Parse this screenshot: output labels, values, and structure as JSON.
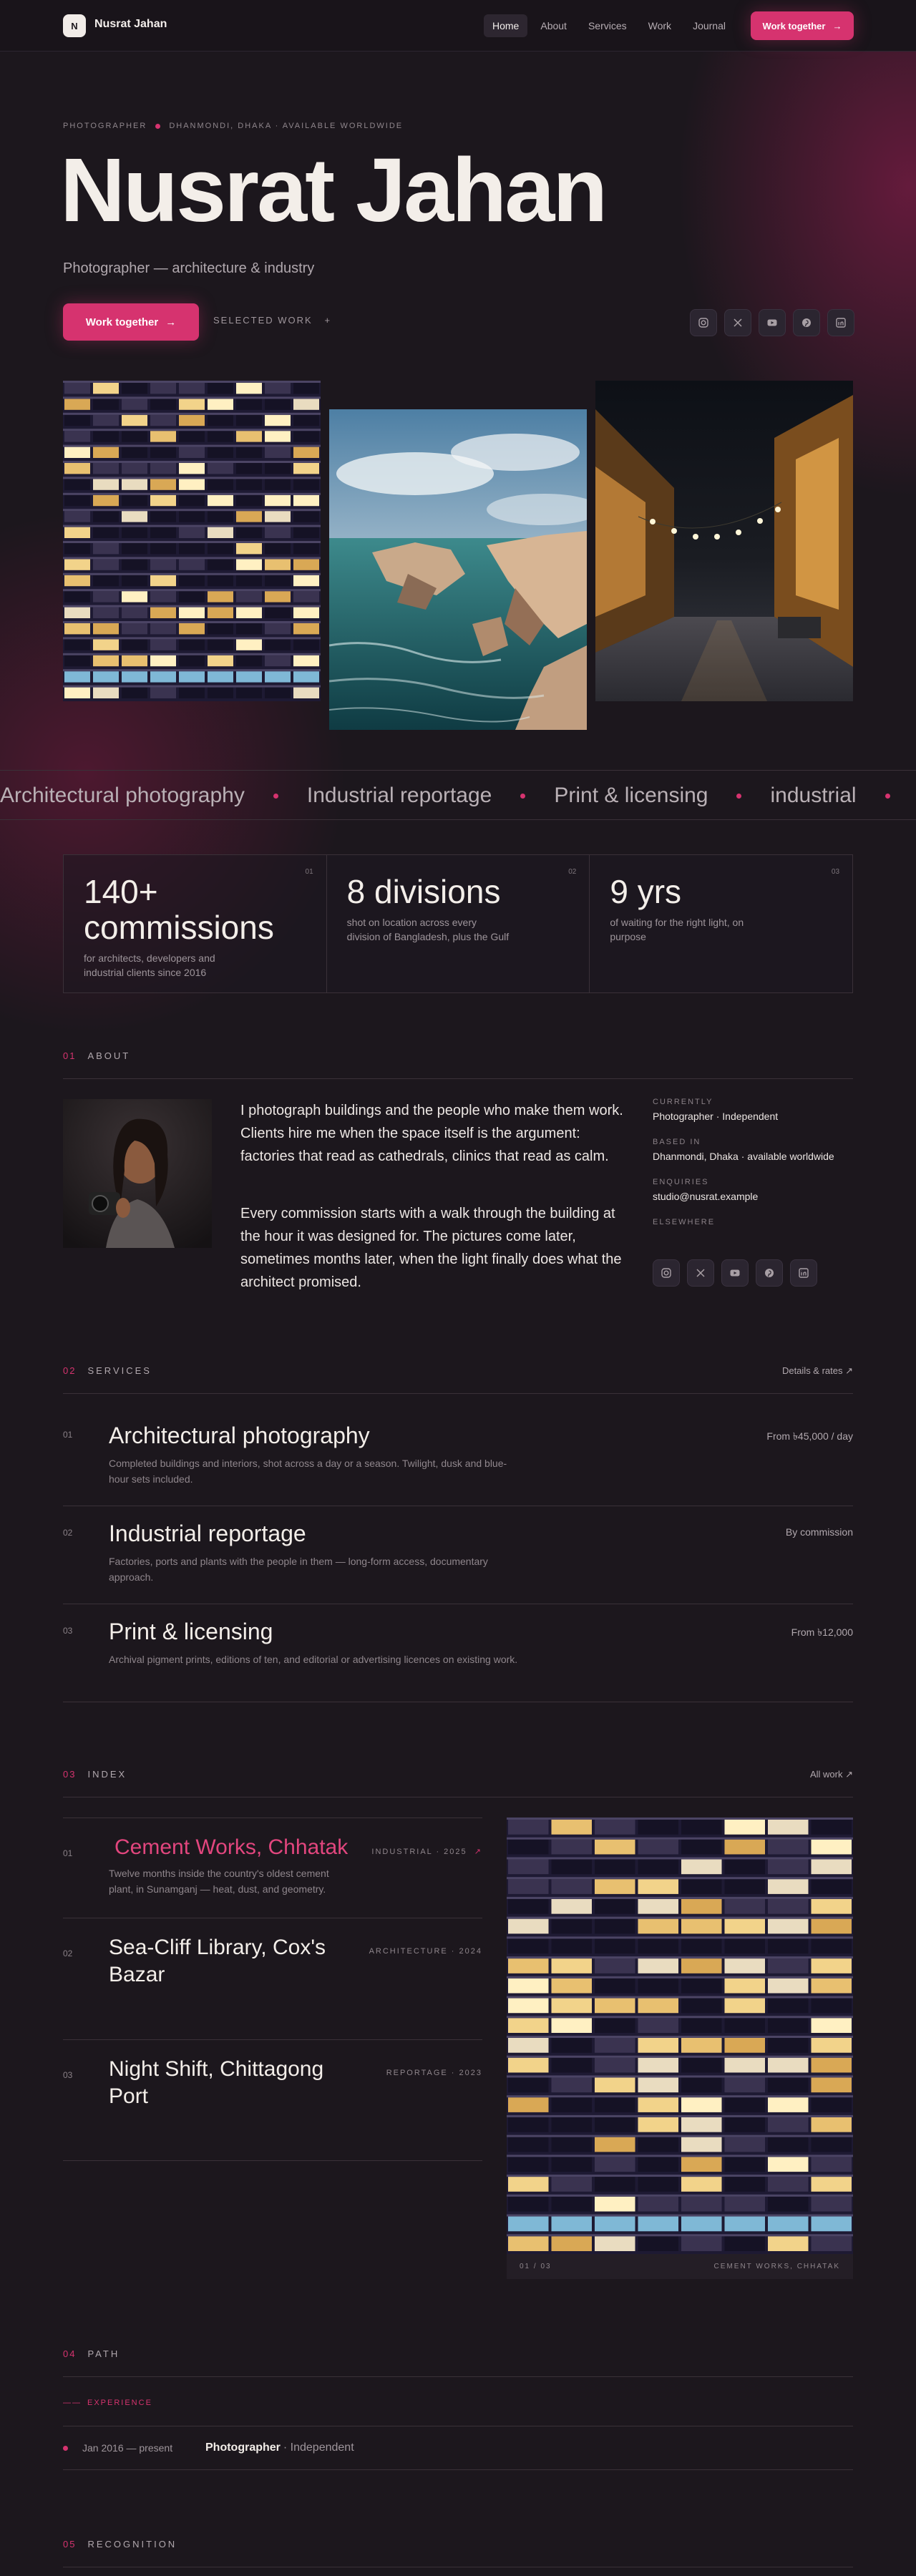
{
  "nav": {
    "logo_letter": "N",
    "brand": "Nusrat Jahan",
    "links": [
      "Home",
      "About",
      "Services",
      "Work",
      "Journal"
    ],
    "cta": "Work together"
  },
  "hero": {
    "eyebrow_role": "PHOTOGRAPHER",
    "eyebrow_location": "DHANMONDI, DHAKA · AVAILABLE WORLDWIDE",
    "title": "Nusrat Jahan",
    "subtitle": "Photographer — architecture & industry",
    "cta": "Work together",
    "secondary": "SELECTED WORK",
    "social_icons": [
      "instagram-icon",
      "x-icon",
      "youtube-icon",
      "pinterest-icon",
      "linkedin-icon"
    ]
  },
  "marquee": [
    "Architectural photography",
    "Industrial reportage",
    "Print & licensing",
    "industrial"
  ],
  "stats": [
    {
      "num": "140+ commissions",
      "desc": "for architects, developers and industrial clients since 2016",
      "idx": "01"
    },
    {
      "num": "8 divisions",
      "desc": "shot on location across every division of Bangladesh, plus the Gulf",
      "idx": "02"
    },
    {
      "num": "9 yrs",
      "desc": "of waiting for the right light, on purpose",
      "idx": "03"
    }
  ],
  "about": {
    "num": "01",
    "label": "ABOUT",
    "p1": "I photograph buildings and the people who make them work. Clients hire me when the space itself is the argument: factories that read as cathedrals, clinics that read as calm.",
    "p2": "Every commission starts with a walk through the building at the hour it was designed for. The pictures come later, sometimes months later, when the light finally does what the architect promised.",
    "facts": [
      {
        "label": "CURRENTLY",
        "value": "Photographer · Independent"
      },
      {
        "label": "BASED IN",
        "value": "Dhanmondi, Dhaka · available worldwide"
      },
      {
        "label": "ENQUIRIES",
        "value": "studio@nusrat.example"
      },
      {
        "label": "ELSEWHERE",
        "value": ""
      }
    ]
  },
  "services": {
    "num": "02",
    "label": "SERVICES",
    "right": "Details & rates ↗",
    "items": [
      {
        "num": "01",
        "title": "Architectural photography",
        "desc": "Completed buildings and interiors, shot across a day or a season. Twilight, dusk and blue-hour sets included.",
        "price": "From ৳45,000 / day"
      },
      {
        "num": "02",
        "title": "Industrial reportage",
        "desc": "Factories, ports and plants with the people in them — long-form access, documentary approach.",
        "price": "By commission"
      },
      {
        "num": "03",
        "title": "Print & licensing",
        "desc": "Archival pigment prints, editions of ten, and editorial or advertising licences on existing work.",
        "price": "From ৳12,000"
      }
    ]
  },
  "index": {
    "num": "03",
    "label": "INDEX",
    "right": "All work ↗",
    "items": [
      {
        "num": "01",
        "title": "Cement Works, Chhatak",
        "meta": "INDUSTRIAL · 2025",
        "desc": "Twelve months inside the country's oldest cement plant, in Sunamganj — heat, dust, and geometry."
      },
      {
        "num": "02",
        "title": "Sea-Cliff Library, Cox's Bazar",
        "meta": "ARCHITECTURE · 2024",
        "desc": ""
      },
      {
        "num": "03",
        "title": "Night Shift, Chittagong Port",
        "meta": "REPORTAGE · 2023",
        "desc": ""
      }
    ],
    "caption_count": "01 / 03",
    "caption_title": "CEMENT WORKS, CHHATAK"
  },
  "path": {
    "num": "04",
    "label": "PATH",
    "experience_label": "EXPERIENCE",
    "date": "Jan 2016 — present",
    "role": "Photographer",
    "org": "· Independent"
  },
  "recognition": {
    "num": "05",
    "label": "RECOGNITION"
  },
  "colors": {
    "accent": "#d6336f",
    "background": "#1c171d",
    "text": "#efeae7"
  }
}
